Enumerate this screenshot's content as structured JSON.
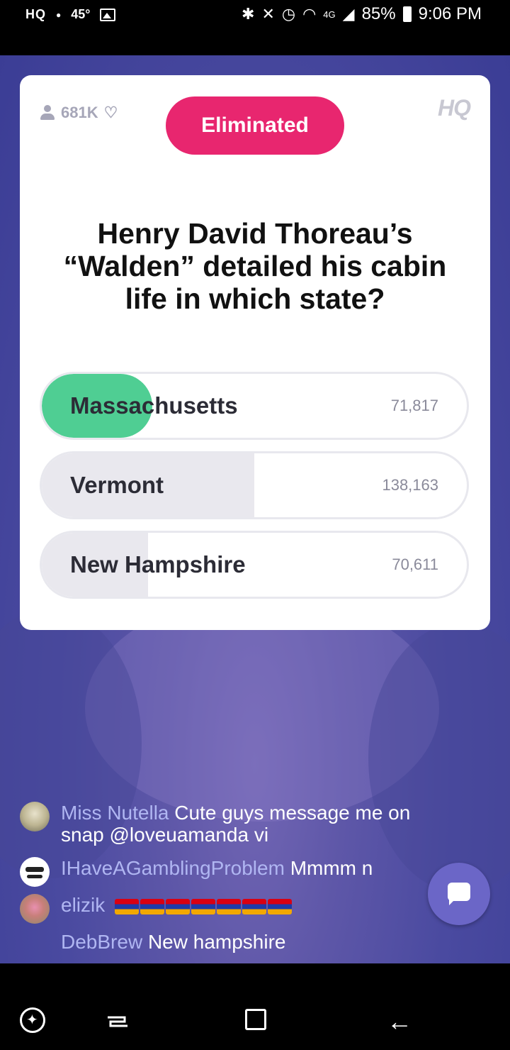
{
  "status_bar": {
    "app_indicator": "HQ",
    "temperature": "45°",
    "battery": "85%",
    "time": "9:06 PM",
    "network": "4G"
  },
  "card": {
    "viewer_count": "681K",
    "status_badge": "Eliminated",
    "logo": "HQ",
    "question": "Henry David Thoreau’s “Walden” detailed his cabin life in which state?",
    "answers": [
      {
        "label": "Massachusetts",
        "count": "71,817",
        "share": 0.26,
        "correct": true
      },
      {
        "label": "Vermont",
        "count": "138,163",
        "share": 0.5,
        "correct": false
      },
      {
        "label": "New Hampshire",
        "count": "70,611",
        "share": 0.25,
        "correct": false
      }
    ],
    "colors": {
      "eliminated": "#e8266f",
      "correct": "#4fce93",
      "wrong": "#e9e8ee"
    }
  },
  "chat": {
    "messages": [
      {
        "user": "Miss Nutella",
        "text": "Cute guys message me on snap @loveuamanda vi"
      },
      {
        "user": "IHaveAGamblingProblem",
        "text": "Mmmm n"
      },
      {
        "user": "elizik",
        "text": "",
        "flags": "armenia-flag x7"
      },
      {
        "user": "DebBrew",
        "text": "New hampshire"
      }
    ]
  },
  "icons": {
    "chat_button": "chat-bubble-icon",
    "nav": [
      "game-launcher-icon",
      "recent-apps-icon",
      "home-icon",
      "back-icon"
    ]
  }
}
